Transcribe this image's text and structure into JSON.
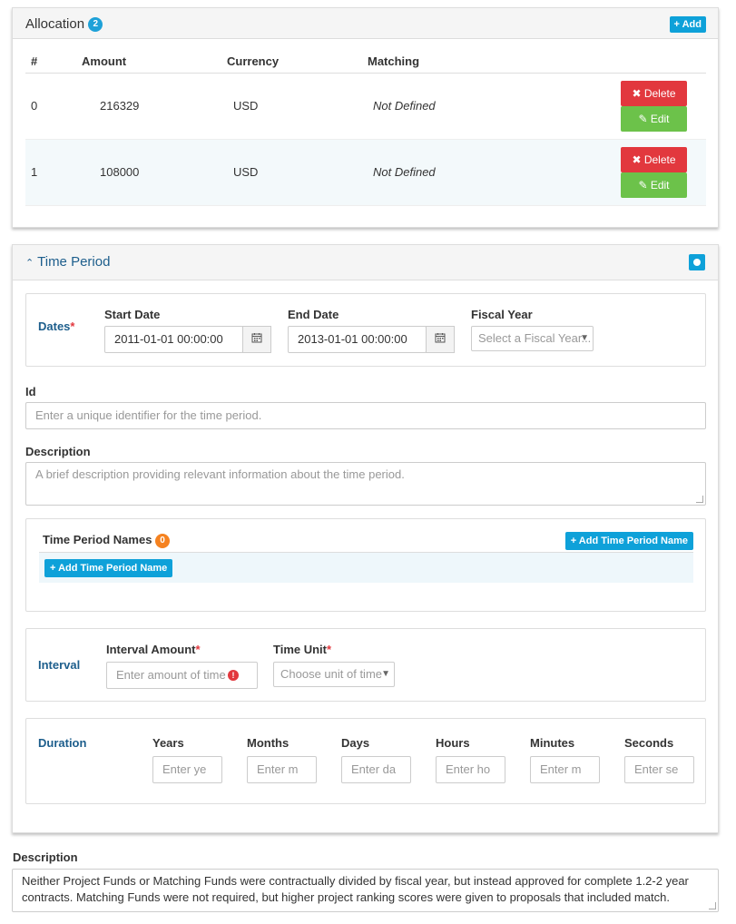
{
  "allocation": {
    "title": "Allocation",
    "count": "2",
    "add_label": "+ Add",
    "columns": [
      "#",
      "Amount",
      "Currency",
      "Matching"
    ],
    "rows": [
      {
        "index": "0",
        "amount": "216329",
        "currency": "USD",
        "matching": "Not Defined"
      },
      {
        "index": "1",
        "amount": "108000",
        "currency": "USD",
        "matching": "Not Defined"
      }
    ],
    "delete_label": "✖ Delete",
    "edit_label": "✎ Edit"
  },
  "time_period": {
    "title": "Time Period",
    "collapse_icon": "chevron-up-icon",
    "dates": {
      "label": "Dates",
      "required_mark": "*",
      "start_label": "Start Date",
      "start_value": "2011-01-01 00:00:00",
      "end_label": "End Date",
      "end_value": "2013-01-01 00:00:00",
      "calendar_icon": "calendar-icon",
      "fiscal_label": "Fiscal Year",
      "fiscal_placeholder": "Select a Fiscal Year..."
    },
    "id": {
      "label": "Id",
      "placeholder": "Enter a unique identifier for the time period."
    },
    "description": {
      "label": "Description",
      "placeholder": "A brief description providing relevant information about the time period."
    },
    "names": {
      "label": "Time Period Names",
      "count": "0",
      "add_label": "+ Add Time Period Name"
    },
    "interval": {
      "label": "Interval",
      "amount_label": "Interval Amount",
      "amount_placeholder": "Enter amount of time",
      "error_mark": "!",
      "unit_label": "Time Unit",
      "unit_placeholder": "Choose unit of time",
      "required_mark": "*"
    },
    "duration": {
      "label": "Duration",
      "fields": [
        {
          "label": "Years",
          "placeholder": "Enter ye"
        },
        {
          "label": "Months",
          "placeholder": "Enter m"
        },
        {
          "label": "Days",
          "placeholder": "Enter da"
        },
        {
          "label": "Hours",
          "placeholder": "Enter ho"
        },
        {
          "label": "Minutes",
          "placeholder": "Enter m"
        },
        {
          "label": "Seconds",
          "placeholder": "Enter se"
        }
      ]
    }
  },
  "description": {
    "label": "Description",
    "value": "Neither Project Funds or Matching Funds were contractually divided by fiscal year, but instead approved for complete 1.2-2  year contracts.  Matching Funds were not required, but higher project ranking scores were given to proposals that included match."
  },
  "colors": {
    "accent": "#0ea1d9",
    "danger": "#e2383e",
    "success": "#6cc24a",
    "heading_blue": "#1d5e8c"
  }
}
